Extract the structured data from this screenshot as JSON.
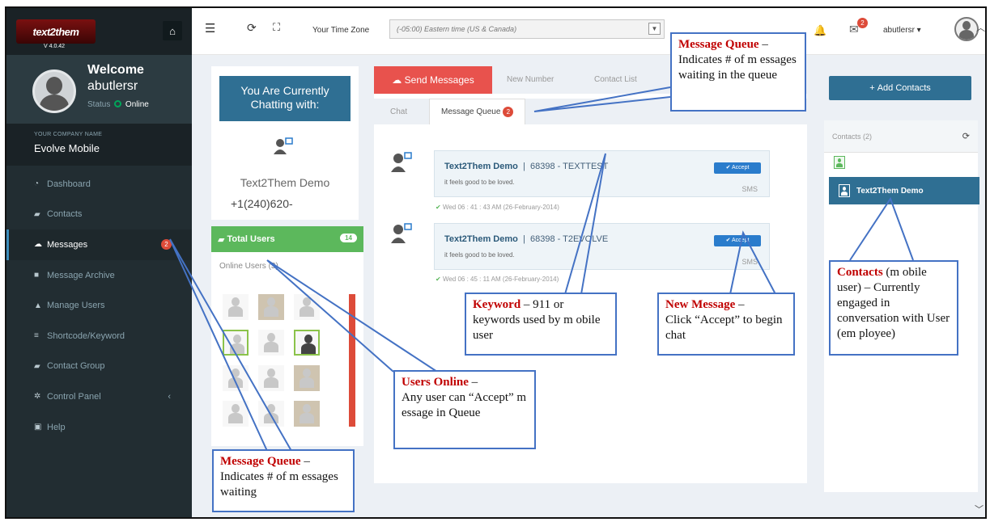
{
  "brand": {
    "logo": "text2them",
    "version": "V 4.0.42"
  },
  "user": {
    "welcome": "Welcome",
    "name": "abutlersr",
    "status_label": "Status",
    "status_value": "Online"
  },
  "company": {
    "label": "YOUR COMPANY NAME",
    "name": "Evolve Mobile"
  },
  "menu": [
    {
      "label": "Dashboard",
      "icon": "dashboard-icon"
    },
    {
      "label": "Contacts",
      "icon": "book-icon"
    },
    {
      "label": "Messages",
      "icon": "chat-icon",
      "badge": "2"
    },
    {
      "label": "Message Archive",
      "icon": "archive-icon"
    },
    {
      "label": "Manage Users",
      "icon": "user-icon"
    },
    {
      "label": "Shortcode/Keyword",
      "icon": "list-icon"
    },
    {
      "label": "Contact Group",
      "icon": "book-icon"
    },
    {
      "label": "Control Panel",
      "icon": "gear-icon"
    },
    {
      "label": "Help",
      "icon": "help-icon"
    }
  ],
  "topbar": {
    "tz_label": "Your Time Zone",
    "tz_value": "(-05:00) Eastern time (US & Canada)",
    "notif_count": "2",
    "username": "abutlersr"
  },
  "chatting": {
    "header": "You Are Currently Chatting with:",
    "name": "Text2Them  Demo",
    "phone": "+1(240)620-"
  },
  "users": {
    "title": "Total Users",
    "count": "14",
    "online_label": "Online Users (3)"
  },
  "messages": {
    "send_button": "Send Messages",
    "tab_new_number": "New Number",
    "tab_contact_list": "Contact List",
    "subtab_chat": "Chat",
    "subtab_queue": "Message Queue",
    "queue_count": "2",
    "items": [
      {
        "sender": "Text2Them Demo",
        "meta": "68398 - TEXTTEST",
        "body": "it feels good to be loved.",
        "accept": "Accept",
        "type": "SMS",
        "time": "Wed 06 : 41 : 43 AM (26-February-2014)"
      },
      {
        "sender": "Text2Them Demo",
        "meta": "68398 - T2EVOLVE",
        "body": "it feels good to be loved.",
        "accept": "Accept",
        "type": "SMS",
        "time": "Wed 06 : 45 : 11 AM (26-February-2014)"
      }
    ]
  },
  "contacts": {
    "add_button": "Add Contacts",
    "header": "Contacts (2)",
    "selected": "Text2Them Demo"
  },
  "annotations": {
    "mq_top": {
      "title": "Message Queue",
      "body": "Indicates # of m essages waiting in the queue"
    },
    "keyword": {
      "title": "Keyword",
      "body": "– 911 or keywords used by m obile user"
    },
    "new_msg": {
      "title": "New  Message",
      "body": "Click  “Accept” to begin chat"
    },
    "contacts": {
      "title": "Contacts",
      "body": "(m obile user) – Currently engaged in conversation with User (em ployee)"
    },
    "users_online": {
      "title": "Users Online",
      "body": "Any user can “Accept” m essage in Queue"
    },
    "mq_bottom": {
      "title": "Message Queue",
      "body": "Indicates # of m essages waiting"
    }
  },
  "colors": {
    "sidebar": "#222d32",
    "primary": "#2f6f93",
    "danger": "#dd4b39",
    "success": "#5cb85c",
    "callout_border": "#4472c4",
    "callout_title": "#c00000"
  }
}
